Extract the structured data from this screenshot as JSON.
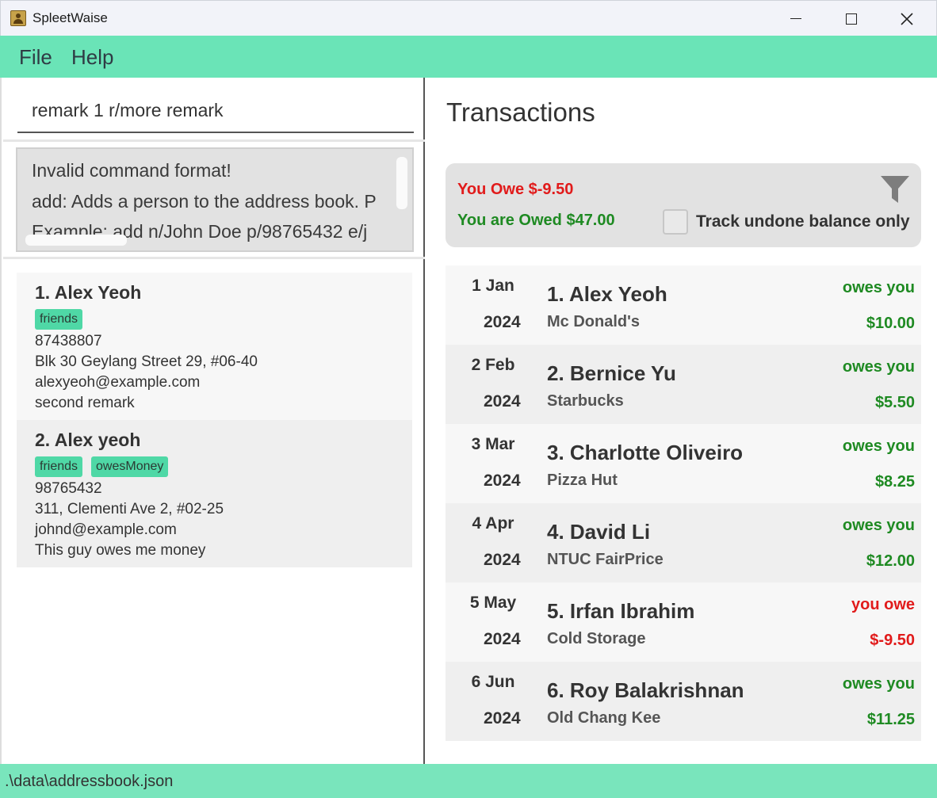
{
  "window": {
    "title": "SpleetWaise"
  },
  "menu": {
    "file": "File",
    "help": "Help"
  },
  "command_box": {
    "value": "remark 1 r/more remark"
  },
  "result_display": {
    "lines": [
      "Invalid command format!",
      "add: Adds a person to the address book. P",
      "Example: add n/John Doe p/98765432 e/j"
    ]
  },
  "persons": [
    {
      "name": "1. Alex Yeoh",
      "tags": [
        "friends"
      ],
      "phone": "87438807",
      "address": "Blk 30 Geylang Street 29, #06-40",
      "email": "alexyeoh@example.com",
      "remark": "second remark"
    },
    {
      "name": "2. Alex yeoh",
      "tags": [
        "friends",
        "owesMoney"
      ],
      "phone": "98765432",
      "address": "311, Clementi Ave 2, #02-25",
      "email": "johnd@example.com",
      "remark": "This guy owes me money"
    }
  ],
  "transactions": {
    "title": "Transactions",
    "summary": {
      "you_owe": "You Owe $-9.50",
      "you_are_owed": "You are Owed $47.00",
      "track_label": "Track undone balance only",
      "track_checked": false
    },
    "items": [
      {
        "date": "1 Jan",
        "year": "2024",
        "name": "1. Alex Yeoh",
        "description": "Mc Donald's",
        "status": "owes you",
        "amount": "$10.00",
        "color": "#1e8a22"
      },
      {
        "date": "2 Feb",
        "year": "2024",
        "name": "2. Bernice Yu",
        "description": "Starbucks",
        "status": "owes you",
        "amount": "$5.50",
        "color": "#1e8a22"
      },
      {
        "date": "3 Mar",
        "year": "2024",
        "name": "3. Charlotte Oliveiro",
        "description": "Pizza Hut",
        "status": "owes you",
        "amount": "$8.25",
        "color": "#1e8a22"
      },
      {
        "date": "4 Apr",
        "year": "2024",
        "name": "4. David Li",
        "description": "NTUC FairPrice",
        "status": "owes you",
        "amount": "$12.00",
        "color": "#1e8a22"
      },
      {
        "date": "5 May",
        "year": "2024",
        "name": "5. Irfan Ibrahim",
        "description": "Cold Storage",
        "status": "you owe",
        "amount": "$-9.50",
        "color": "#e11b1b"
      },
      {
        "date": "6 Jun",
        "year": "2024",
        "name": "6. Roy Balakrishnan",
        "description": "Old Chang Kee",
        "status": "owes you",
        "amount": "$11.25",
        "color": "#1e8a22"
      }
    ]
  },
  "status_bar": {
    "path": ".\\data\\addressbook.json"
  },
  "colors": {
    "accent": "#6ae4b7",
    "tag": "#4fd8a6",
    "positive": "#1e8a22",
    "negative": "#e11b1b"
  },
  "icons": {
    "app": "app-icon",
    "filter": "filter-icon",
    "minimize": "minimize-icon",
    "maximize": "maximize-icon",
    "close": "close-icon"
  }
}
